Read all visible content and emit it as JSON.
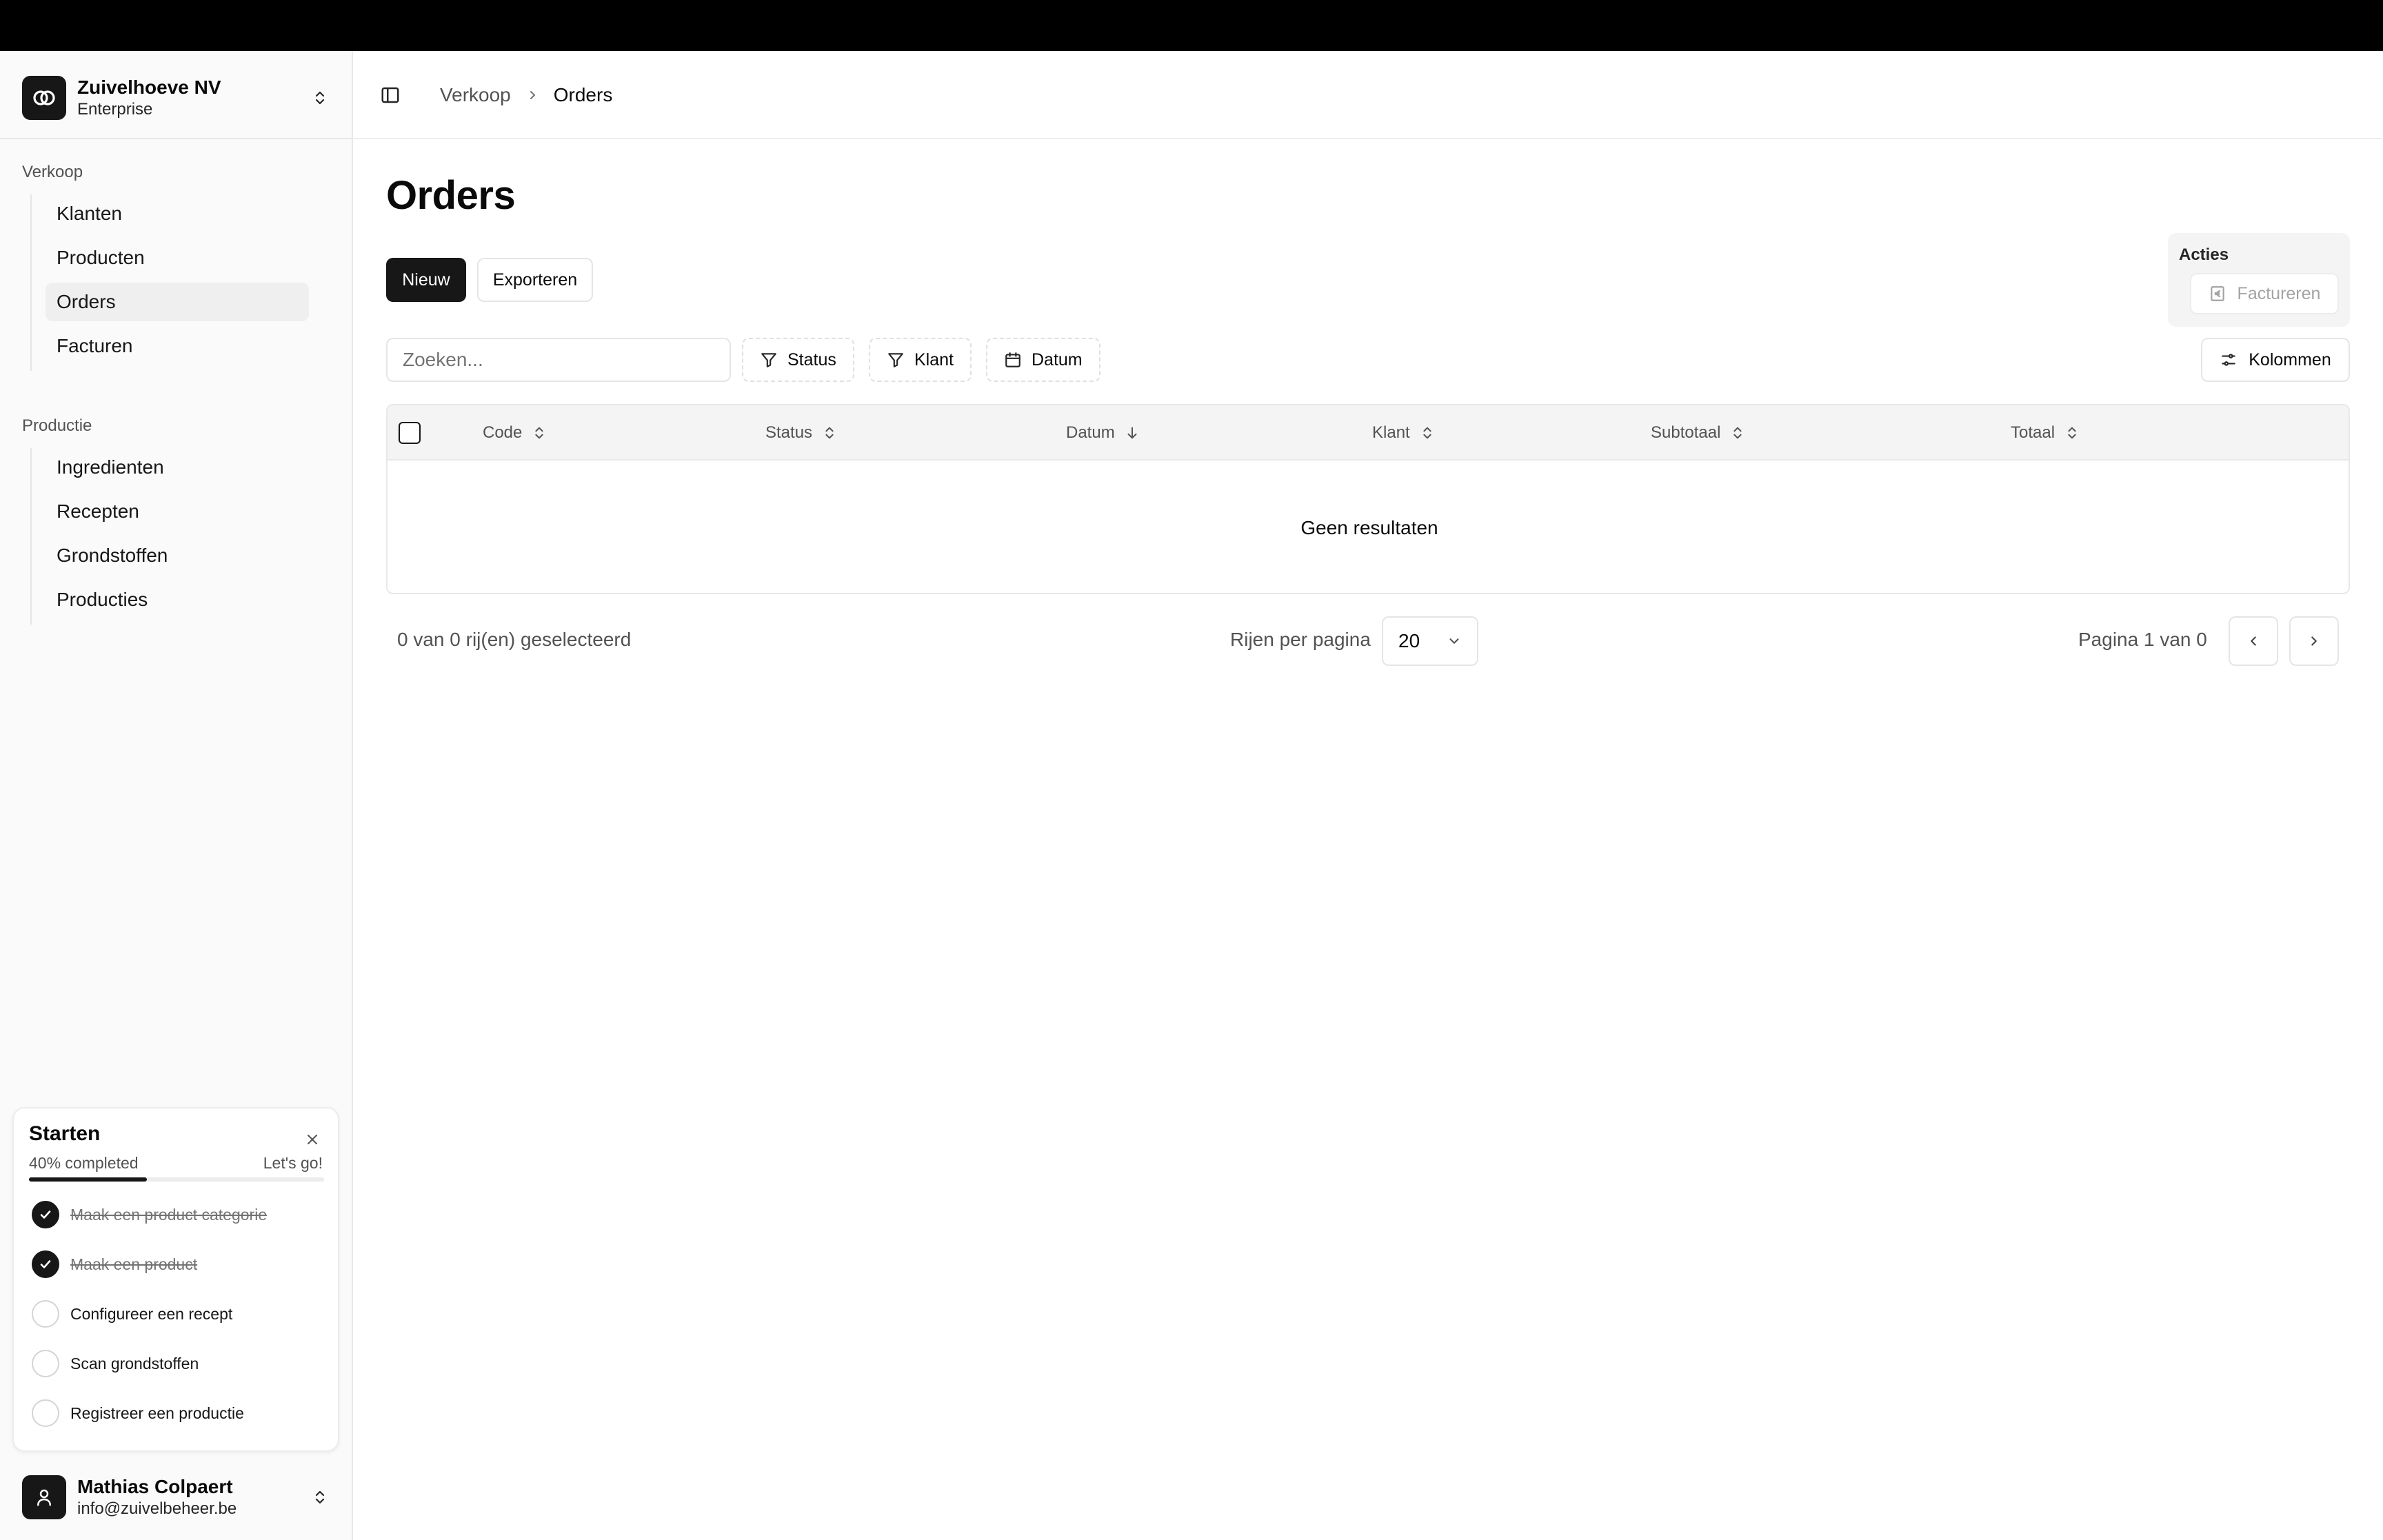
{
  "org": {
    "name": "Zuivelhoeve NV",
    "plan": "Enterprise"
  },
  "sidebar": {
    "groups": [
      {
        "label": "Verkoop",
        "items": [
          "Klanten",
          "Producten",
          "Orders",
          "Facturen"
        ]
      },
      {
        "label": "Productie",
        "items": [
          "Ingredienten",
          "Recepten",
          "Grondstoffen",
          "Producties"
        ]
      }
    ],
    "active_item": "Orders"
  },
  "onboarding": {
    "title": "Starten",
    "progress_text": "40% completed",
    "progress_fraction": 0.4,
    "cta": "Let's go!",
    "tasks": [
      {
        "label": "Maak een product categorie",
        "done": true
      },
      {
        "label": "Maak een product",
        "done": true
      },
      {
        "label": "Configureer een recept",
        "done": false
      },
      {
        "label": "Scan grondstoffen",
        "done": false
      },
      {
        "label": "Registreer een productie",
        "done": false
      }
    ]
  },
  "user": {
    "name": "Mathias Colpaert",
    "email": "info@zuivelbeheer.be"
  },
  "breadcrumb": {
    "parent": "Verkoop",
    "current": "Orders"
  },
  "page": {
    "title": "Orders"
  },
  "toolbar": {
    "new_label": "Nieuw",
    "export_label": "Exporteren"
  },
  "actions": {
    "label": "Acties",
    "invoice_label": "Factureren"
  },
  "search": {
    "placeholder": "Zoeken...",
    "value": ""
  },
  "filters": {
    "status": "Status",
    "customer": "Klant",
    "date": "Datum"
  },
  "columns_button": "Kolommen",
  "table": {
    "columns": [
      "Code",
      "Status",
      "Datum",
      "Klant",
      "Subtotaal",
      "Totaal"
    ],
    "sorted_column": "Datum",
    "sort_direction": "descending",
    "empty_text": "Geen resultaten",
    "rows": []
  },
  "footer": {
    "selection": "0 van 0 rij(en) geselecteerd",
    "rows_per_page_label": "Rijen per pagina",
    "rows_per_page": "20",
    "page_info": "Pagina 1 van 0"
  }
}
